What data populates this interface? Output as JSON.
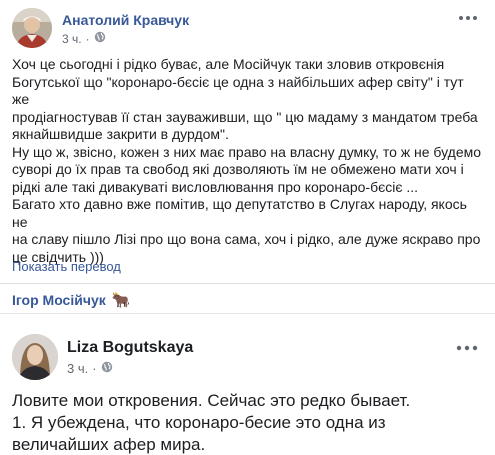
{
  "post": {
    "author": "Анатолий Кравчук",
    "time": "3 ч.",
    "privacy_icon": "globe-icon",
    "more_icon": "ellipsis-icon",
    "text": "Хоч це сьогодні і рідко буває, але Мосійчук таки зловив откровєнія\nБогутської що \"коронаро-бєсіє це одна з найбільших афер світу\" і тут же\nпродіагностував її стан зауваживши, що \" цю мадаму з мандатом треба\nякнайшвидше закрити в дурдом\".\nНу що ж, звісно, кожен з них має право на власну думку, то ж не будемо\nсуворі до їх прав та свобод які дозволяють їм не обмежено мати хоч і\nрідкі але такі дивакуваті висловлювання про коронаро-бєсіє ...\nБагато хто давно вже помітив, що депутатство в Слугах народу, якось не\nна славу пішло Лізі про що вона сама, хоч і рідко, але дуже яскраво про\nце свідчить )))",
    "translate_link": "Показать перевод"
  },
  "tagged": {
    "name": "Ігор Мосійчук",
    "emoji": "🐂"
  },
  "shared": {
    "author": "Liza Bogutskaya",
    "time": "3 ч.",
    "privacy_icon": "globe-icon",
    "more_icon": "ellipsis-icon",
    "text": "Ловите мои откровения. Сейчас это редко бывает.\n1. Я убеждена, что коронаро-бесие это одна из\nвеличайших афер мира."
  },
  "colors": {
    "link": "#385898",
    "meta": "#606770",
    "text": "#1c1e21",
    "divider": "#dadde1"
  }
}
